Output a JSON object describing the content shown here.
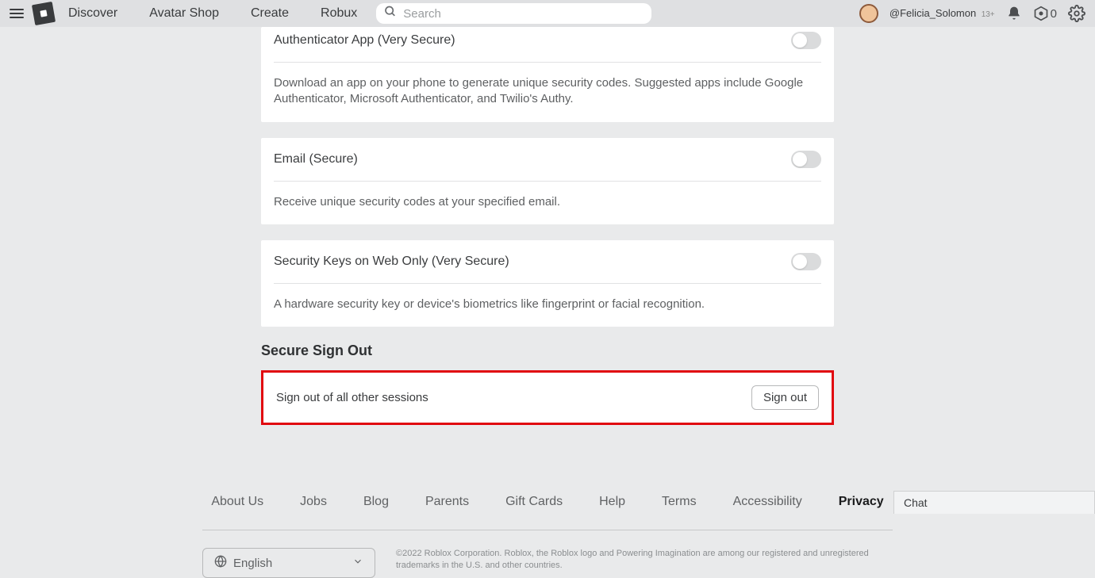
{
  "header": {
    "nav": {
      "discover": "Discover",
      "avatar_shop": "Avatar Shop",
      "create": "Create",
      "robux": "Robux"
    },
    "search_placeholder": "Search",
    "user": {
      "handle": "@Felicia_Solomon",
      "age_badge": "13+"
    },
    "robux_count": "0"
  },
  "security": {
    "auth_app": {
      "title": "Authenticator App (Very Secure)",
      "desc": "Download an app on your phone to generate unique security codes. Suggested apps include Google Authenticator, Microsoft Authenticator, and Twilio's Authy."
    },
    "email": {
      "title": "Email (Secure)",
      "desc": "Receive unique security codes at your specified email."
    },
    "keys": {
      "title": "Security Keys on Web Only (Very Secure)",
      "desc": "A hardware security key or device's biometrics like fingerprint or facial recognition."
    }
  },
  "signout": {
    "heading": "Secure Sign Out",
    "label": "Sign out of all other sessions",
    "button": "Sign out"
  },
  "footer": {
    "links": {
      "about": "About Us",
      "jobs": "Jobs",
      "blog": "Blog",
      "parents": "Parents",
      "gift": "Gift Cards",
      "help": "Help",
      "terms": "Terms",
      "accessibility": "Accessibility",
      "privacy": "Privacy"
    },
    "language": "English",
    "legal": "©2022 Roblox Corporation. Roblox, the Roblox logo and Powering Imagination are among our registered and unregistered trademarks in the U.S. and other countries."
  },
  "chat": {
    "label": "Chat"
  }
}
